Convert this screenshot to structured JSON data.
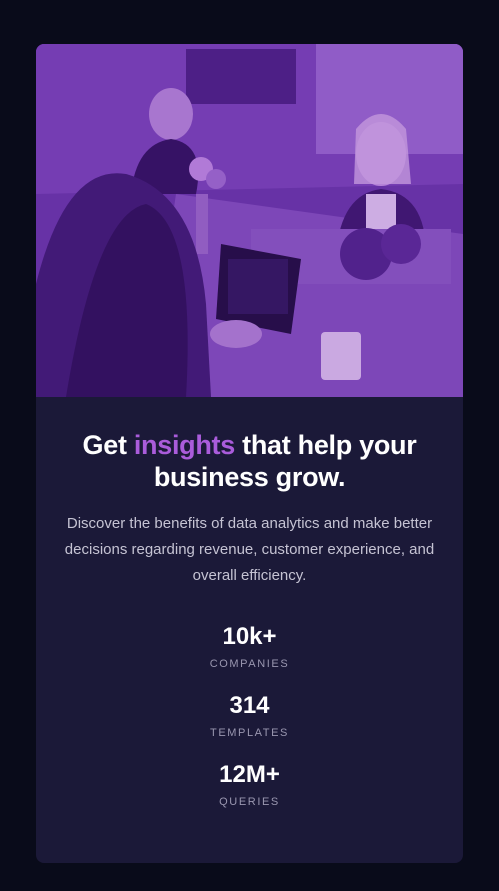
{
  "hero": {
    "image_alt": "team-working-at-desk-photo",
    "tint_color": "#aa5cdb"
  },
  "headline": {
    "prefix": "Get ",
    "accent": "insights",
    "suffix": " that help your business grow."
  },
  "description": "Discover the benefits of data analytics and make better decisions regarding revenue, customer experience, and overall efficiency.",
  "stats": [
    {
      "value": "10k+",
      "label": "COMPANIES"
    },
    {
      "value": "314",
      "label": "TEMPLATES"
    },
    {
      "value": "12M+",
      "label": "QUERIES"
    }
  ],
  "colors": {
    "page_background": "#090b1a",
    "card_background": "#1b1938",
    "accent": "#aa5cdb",
    "text_main": "#ffffff",
    "text_muted": "#c5c3d3"
  }
}
